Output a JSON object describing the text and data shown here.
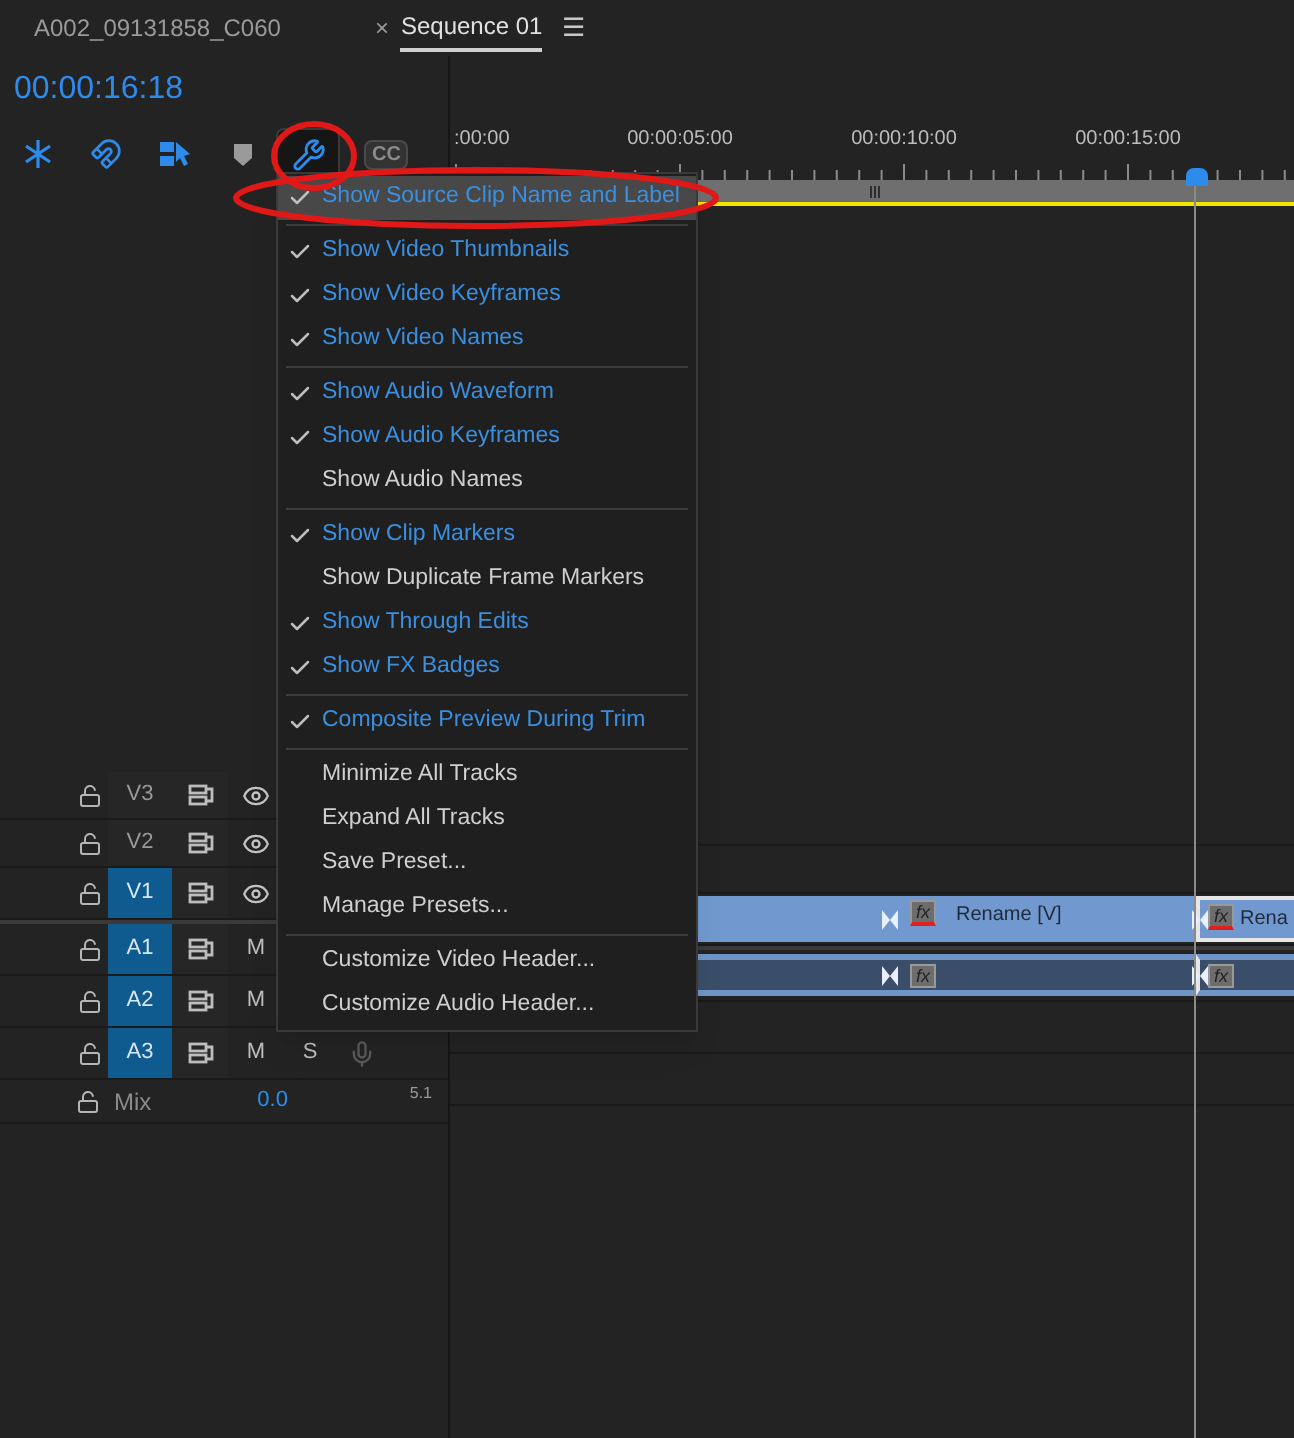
{
  "tabs": [
    {
      "label": "A002_09131858_C060",
      "selected": false
    },
    {
      "label": "Sequence 01",
      "selected": true,
      "close_glyph": "×",
      "menu_glyph": "☰"
    }
  ],
  "timecode": "00:00:16:18",
  "toolbar": [
    {
      "kind": "snap",
      "selected": false
    },
    {
      "kind": "magnet",
      "selected": false
    },
    {
      "kind": "linked-selection",
      "selected": false
    },
    {
      "kind": "marker",
      "selected": false
    },
    {
      "kind": "wrench",
      "selected": true
    },
    {
      "kind": "captions",
      "label": "CC",
      "selected": false
    }
  ],
  "ruler": {
    "labels": [
      ":00:00",
      "00:00:05:00",
      "00:00:10:00",
      "00:00:15:00"
    ],
    "playhead": {
      "level": 0.884
    }
  },
  "menu": {
    "groups": [
      {
        "items": [
          {
            "label": "Show Source Clip Name and Label",
            "kind": "toggle",
            "checked": true,
            "selected": true
          }
        ]
      },
      {
        "items": [
          {
            "label": "Show Video Thumbnails",
            "kind": "toggle",
            "checked": true,
            "selected": false
          },
          {
            "label": "Show Video Keyframes",
            "kind": "toggle",
            "checked": true,
            "selected": false
          },
          {
            "label": "Show Video Names",
            "kind": "toggle",
            "checked": true,
            "selected": false
          }
        ]
      },
      {
        "items": [
          {
            "label": "Show Audio Waveform",
            "kind": "toggle",
            "checked": true,
            "selected": false
          },
          {
            "label": "Show Audio Keyframes",
            "kind": "toggle",
            "checked": true,
            "selected": false
          },
          {
            "label": "Show Audio Names",
            "kind": "toggle",
            "checked": false,
            "selected": false
          }
        ]
      },
      {
        "items": [
          {
            "label": "Show Clip Markers",
            "kind": "toggle",
            "checked": true,
            "selected": false
          },
          {
            "label": "Show Duplicate Frame Markers",
            "kind": "toggle",
            "checked": false,
            "selected": false
          },
          {
            "label": "Show Through Edits",
            "kind": "toggle",
            "checked": true,
            "selected": false
          },
          {
            "label": "Show FX Badges",
            "kind": "toggle",
            "checked": true,
            "selected": false
          }
        ]
      },
      {
        "items": [
          {
            "label": "Composite Preview During Trim",
            "kind": "toggle",
            "checked": true,
            "selected": false
          }
        ]
      },
      {
        "items": [
          {
            "label": "Minimize All Tracks",
            "kind": "action",
            "selected": false
          },
          {
            "label": "Expand All Tracks",
            "kind": "action",
            "selected": false
          },
          {
            "label": "Save Preset...",
            "kind": "action",
            "selected": false
          },
          {
            "label": "Manage Presets...",
            "kind": "action",
            "selected": false
          }
        ]
      },
      {
        "items": [
          {
            "label": "Customize Video Header...",
            "kind": "action",
            "selected": false
          },
          {
            "label": "Customize Audio Header...",
            "kind": "action",
            "selected": false
          }
        ]
      }
    ]
  },
  "tracks": [
    {
      "kind": "video",
      "label": "V3",
      "targeted": false
    },
    {
      "kind": "video",
      "label": "V2",
      "targeted": false
    },
    {
      "kind": "video",
      "label": "V1",
      "targeted": true,
      "clips": [
        {
          "kind": "clip"
        },
        {
          "kind": "clip",
          "fx": "fx",
          "label": "Rename [V]"
        },
        {
          "kind": "clip",
          "fx": "fx",
          "label": "Rena"
        }
      ]
    },
    {
      "kind": "audio",
      "label": "A1",
      "targeted": true,
      "mute": "M",
      "clips": [
        {
          "kind": "clip"
        },
        {
          "kind": "clip",
          "fx": "fx"
        },
        {
          "kind": "clip",
          "fx": "fx"
        }
      ]
    },
    {
      "kind": "audio",
      "label": "A2",
      "targeted": true,
      "mute": "M"
    },
    {
      "kind": "audio",
      "label": "A3",
      "targeted": true,
      "mute": "M",
      "solo": "S",
      "voiceover": true
    }
  ],
  "mix": {
    "label": "Mix",
    "value": "0.0",
    "channels": "5.1"
  }
}
